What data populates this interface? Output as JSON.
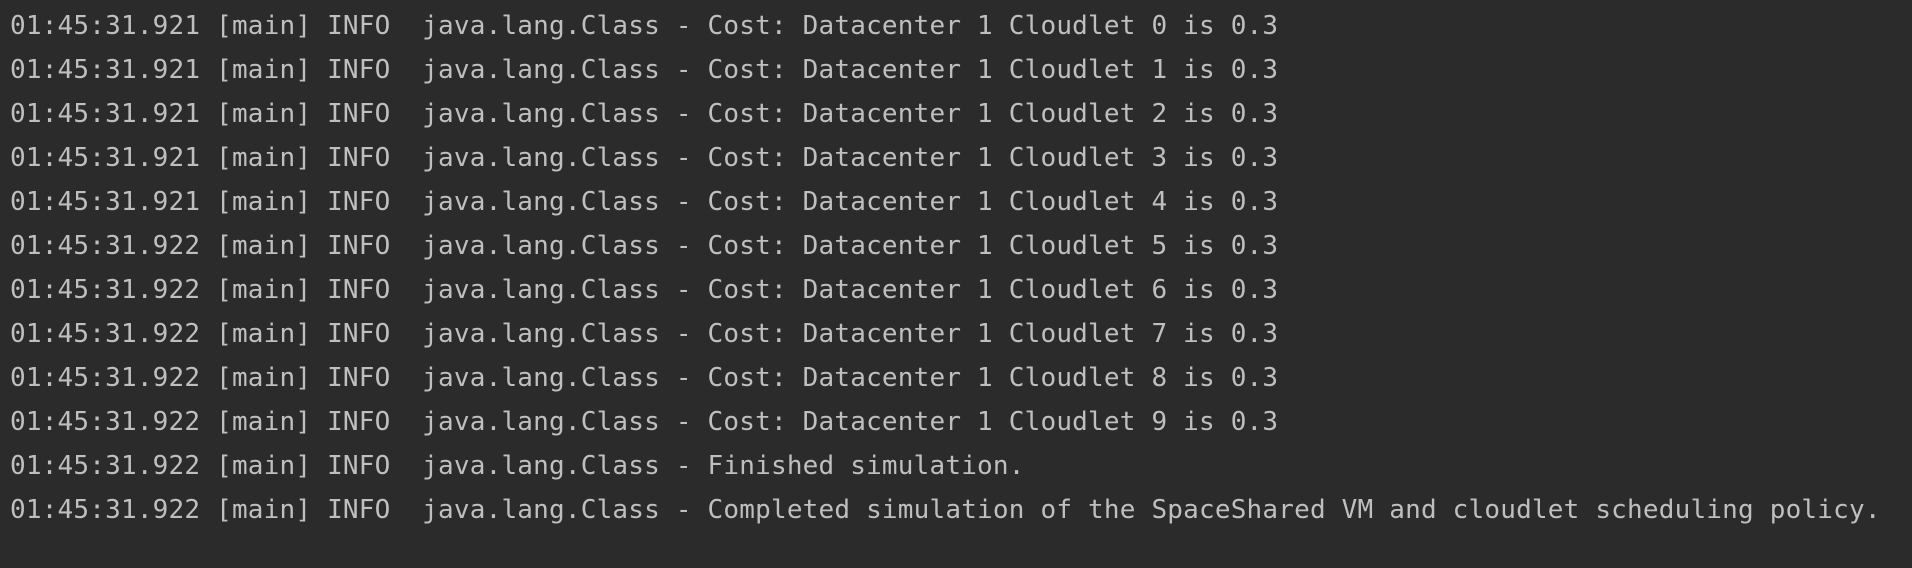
{
  "console": {
    "lines": [
      "01:45:31.921 [main] INFO  java.lang.Class - Cost: Datacenter 1 Cloudlet 0 is 0.3",
      "01:45:31.921 [main] INFO  java.lang.Class - Cost: Datacenter 1 Cloudlet 1 is 0.3",
      "01:45:31.921 [main] INFO  java.lang.Class - Cost: Datacenter 1 Cloudlet 2 is 0.3",
      "01:45:31.921 [main] INFO  java.lang.Class - Cost: Datacenter 1 Cloudlet 3 is 0.3",
      "01:45:31.921 [main] INFO  java.lang.Class - Cost: Datacenter 1 Cloudlet 4 is 0.3",
      "01:45:31.922 [main] INFO  java.lang.Class - Cost: Datacenter 1 Cloudlet 5 is 0.3",
      "01:45:31.922 [main] INFO  java.lang.Class - Cost: Datacenter 1 Cloudlet 6 is 0.3",
      "01:45:31.922 [main] INFO  java.lang.Class - Cost: Datacenter 1 Cloudlet 7 is 0.3",
      "01:45:31.922 [main] INFO  java.lang.Class - Cost: Datacenter 1 Cloudlet 8 is 0.3",
      "01:45:31.922 [main] INFO  java.lang.Class - Cost: Datacenter 1 Cloudlet 9 is 0.3",
      "01:45:31.922 [main] INFO  java.lang.Class - Finished simulation.",
      "01:45:31.922 [main] INFO  java.lang.Class - Completed simulation of the SpaceShared VM and cloudlet scheduling policy."
    ],
    "colors": {
      "background": "#2b2b2b",
      "text": "#bfbfbf"
    }
  }
}
